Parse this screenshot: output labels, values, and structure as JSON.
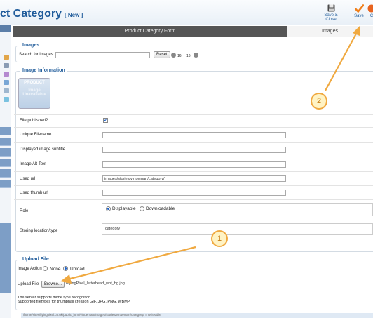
{
  "header": {
    "title": "ct Category",
    "status_tag": "[ New ]",
    "save_close_label": "Save & Close",
    "save_label": "Save",
    "cut_label": "C"
  },
  "tabs": {
    "active_label": "Product Category Form",
    "images_label": "Images"
  },
  "images": {
    "legend": "Images",
    "search_label": "Search for images",
    "search_value": "",
    "reset_label": "Reset",
    "page_a": "16",
    "page_b": "16"
  },
  "image_info": {
    "legend": "Image Information",
    "placeholder_line1": "PRODUCT",
    "placeholder_line2": "Image Unavailable",
    "fields": {
      "published_label": "File published?",
      "unique_label": "Unique Filename",
      "unique_value": "",
      "subtitle_label": "Displayed image subtitle",
      "subtitle_value": "",
      "alt_label": "Image Alt-Text",
      "alt_value": "",
      "url_label": "Used url",
      "url_value": "images/stories/virtuemart/category/",
      "thumb_label": "Used thumb url",
      "thumb_value": "",
      "role_label": "Role",
      "role_opt1": "Displayable",
      "role_opt2": "Downloadable",
      "storing_label": "Storing location/type",
      "storing_value": "category"
    }
  },
  "upload": {
    "legend": "Upload File",
    "action_label": "Image Action",
    "opt_none": "None",
    "opt_upload": "Upload",
    "file_label": "Upload File",
    "browse_label": "Browse...",
    "file_name": "FlyingPixel_letterhead_wht_bg.jpg",
    "note_line1": "The server supports mime type recognition",
    "note_line2": "Supported filetypes for thumbnail creation GIF, JPG, PNG, WBMP",
    "path_text": "/home/sites/flyingpixel.co.uk/public_html/virtuemart/images/stories/virtuemart/category/ = Writeable"
  },
  "annotations": {
    "badge1": "1",
    "badge2": "2",
    "accent": "#f0a940"
  },
  "colors": {
    "brand": "#1f5b9a",
    "save_check": "#f07f1a",
    "active_tab": "#555555"
  }
}
